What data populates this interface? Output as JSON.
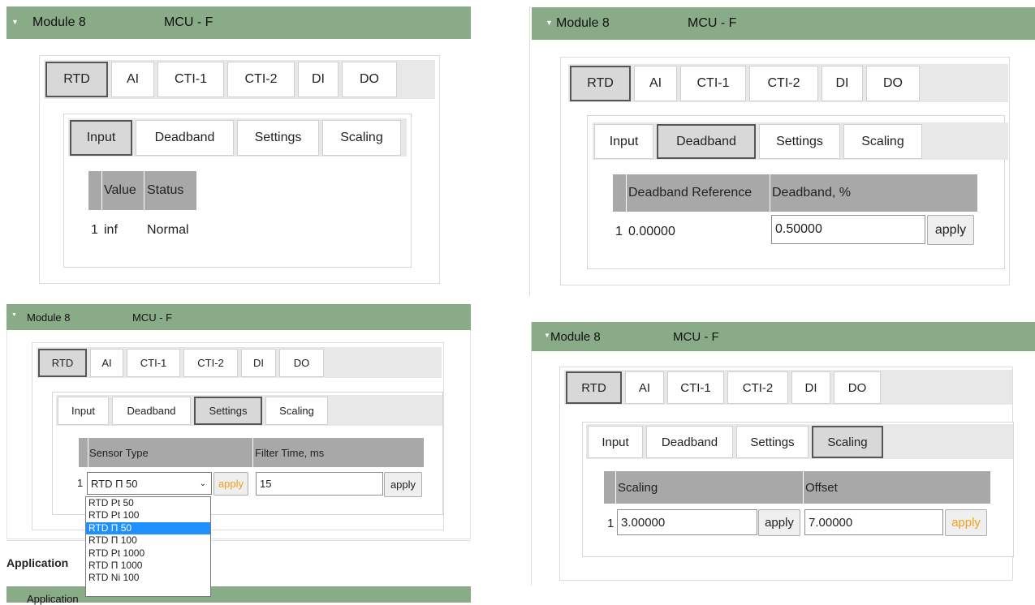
{
  "module": {
    "name": "Module 8",
    "type": "MCU - F"
  },
  "main_tabs": [
    "RTD",
    "AI",
    "CTI-1",
    "CTI-2",
    "DI",
    "DO"
  ],
  "sub_tabs": [
    "Input",
    "Deadband",
    "Settings",
    "Scaling"
  ],
  "input_panel": {
    "headers": [
      "Value",
      "Status"
    ],
    "row": {
      "index": "1",
      "value": "inf",
      "status": "Normal"
    }
  },
  "deadband_panel": {
    "headers": [
      "Deadband Reference",
      "Deadband, %"
    ],
    "row": {
      "index": "1",
      "reference": "0.00000",
      "deadband": "0.50000"
    },
    "apply": "apply"
  },
  "settings_panel": {
    "headers": [
      "Sensor Type",
      "Filter Time, ms"
    ],
    "row": {
      "index": "1",
      "sensor_type": "RTD П 50",
      "filter_time": "15"
    },
    "apply": "apply",
    "dropdown_options": [
      "RTD Pt 50",
      "RTD Pt 100",
      "RTD П 50",
      "RTD П 100",
      "RTD Pt 1000",
      "RTD П 1000",
      "RTD Ni 100"
    ],
    "selected_option": "RTD П 50"
  },
  "scaling_panel": {
    "headers": [
      "Scaling",
      "Offset"
    ],
    "row": {
      "index": "1",
      "scaling": "3.00000",
      "offset": "7.00000"
    },
    "apply": "apply"
  },
  "application": {
    "heading": "Application",
    "bar_label": "Application"
  },
  "colors": {
    "header_green": "#8aab88",
    "table_header": "#a8a8a8",
    "apply_orange": "#f0a020",
    "highlight": "#1e90ff"
  }
}
